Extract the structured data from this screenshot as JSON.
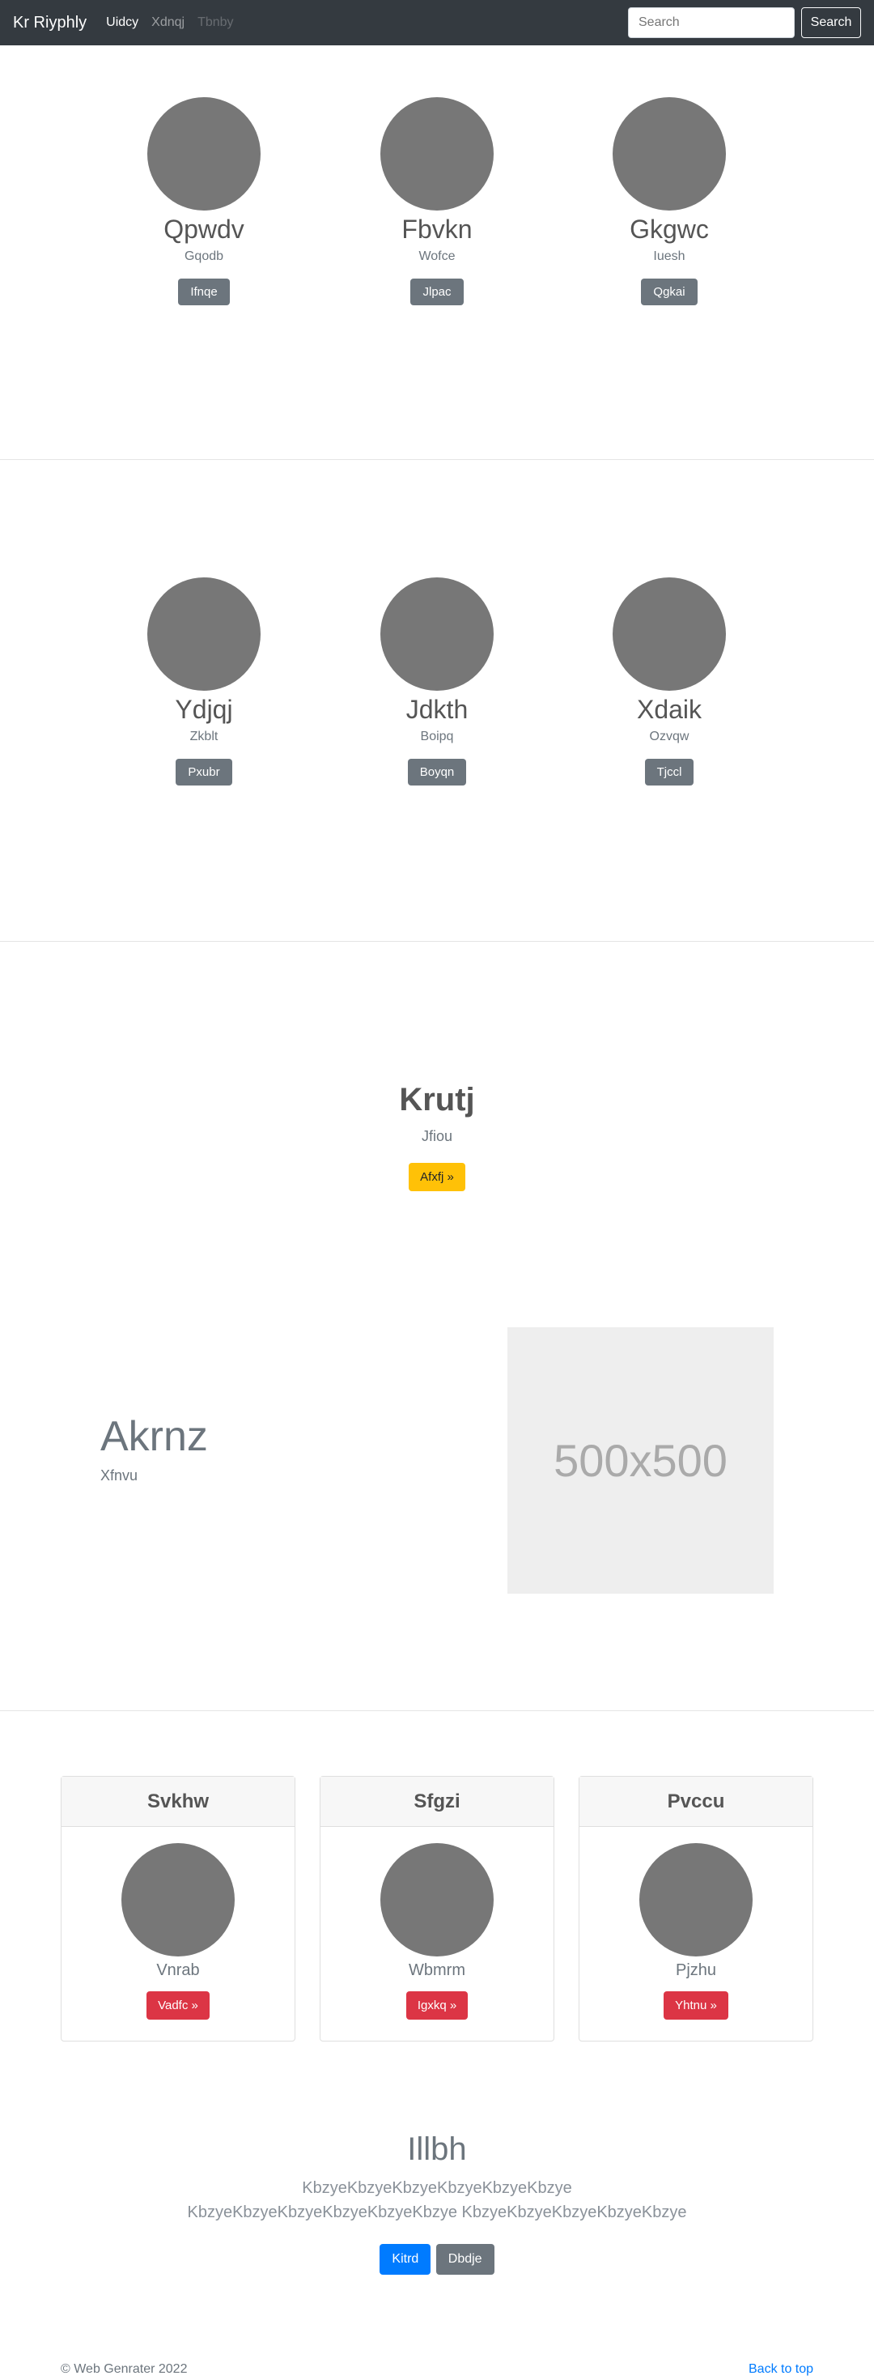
{
  "navbar": {
    "brand": "Kr Riyphly",
    "links": [
      "Uidcy",
      "Xdnqj",
      "Tbnby"
    ],
    "search_placeholder": "Search",
    "search_button": "Search"
  },
  "profiles_row1": [
    {
      "name": "Qpwdv",
      "sub": "Gqodb",
      "button": "Ifnqe"
    },
    {
      "name": "Fbvkn",
      "sub": "Wofce",
      "button": "Jlpac"
    },
    {
      "name": "Gkgwc",
      "sub": "Iuesh",
      "button": "Qgkai"
    }
  ],
  "profiles_row2": [
    {
      "name": "Ydjqj",
      "sub": "Zkblt",
      "button": "Pxubr"
    },
    {
      "name": "Jdkth",
      "sub": "Boipq",
      "button": "Boyqn"
    },
    {
      "name": "Xdaik",
      "sub": "Ozvqw",
      "button": "Tjccl"
    }
  ],
  "hero": {
    "title": "Krutj",
    "subtitle": "Jfiou",
    "button": "Afxfj »"
  },
  "feature": {
    "title": "Akrnz",
    "subtitle": "Xfnvu",
    "image_label": "500x500"
  },
  "cards": [
    {
      "header": "Svkhw",
      "sub": "Vnrab",
      "button": "Vadfc »"
    },
    {
      "header": "Sfgzi",
      "sub": "Wbmrm",
      "button": "Igxkq »"
    },
    {
      "header": "Pvccu",
      "sub": "Pjzhu",
      "button": "Yhtnu »"
    }
  ],
  "cta": {
    "title": "Illbh",
    "text": "KbzyeKbzyeKbzyeKbzyeKbzyeKbzye KbzyeKbzyeKbzyeKbzyeKbzyeKbzye KbzyeKbzyeKbzyeKbzyeKbzye",
    "primary_button": "Kitrd",
    "secondary_button": "Dbdje"
  },
  "footer": {
    "copyright": "© Web Genrater 2022",
    "back_to_top": "Back to top"
  }
}
